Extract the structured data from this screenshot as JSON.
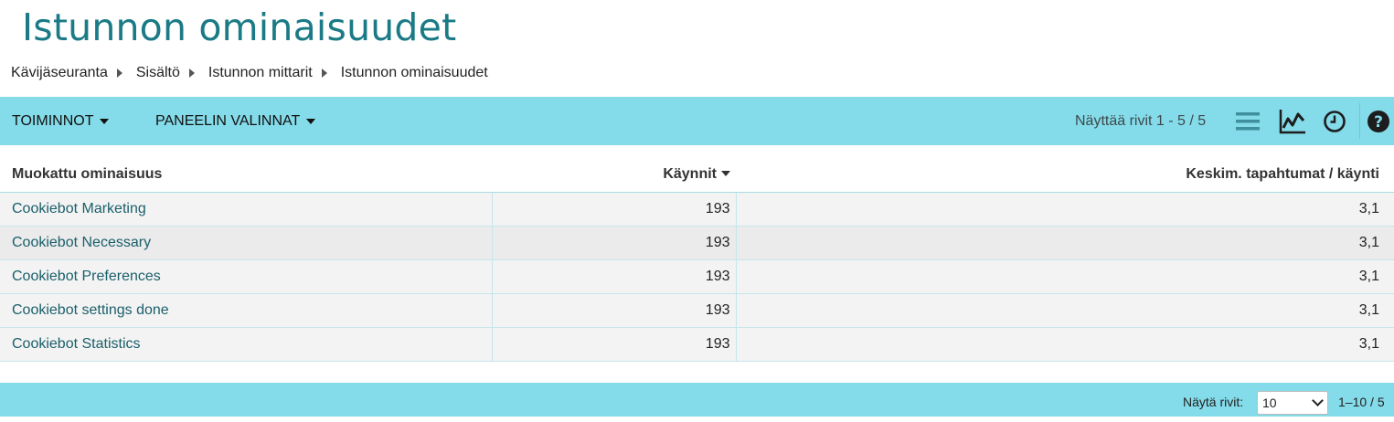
{
  "page": {
    "title": "Istunnon ominaisuudet"
  },
  "breadcrumb": [
    "Kävijäseuranta",
    "Sisältö",
    "Istunnon mittarit",
    "Istunnon ominaisuudet"
  ],
  "toolbar": {
    "actions_label": "TOIMINNOT",
    "panel_options_label": "PANEELIN VALINNAT",
    "rows_info": "Näyttää rivit 1 - 5 / 5",
    "icons": [
      "table-view-icon",
      "line-chart-icon",
      "clock-icon",
      "help-icon"
    ]
  },
  "table": {
    "columns": [
      "Muokattu ominaisuus",
      "Käynnit",
      "Keskim. tapahtumat / käynti"
    ],
    "rows": [
      [
        "Cookiebot Marketing",
        "193",
        "3,1"
      ],
      [
        "Cookiebot Necessary",
        "193",
        "3,1"
      ],
      [
        "Cookiebot Preferences",
        "193",
        "3,1"
      ],
      [
        "Cookiebot settings done",
        "193",
        "3,1"
      ],
      [
        "Cookiebot Statistics",
        "193",
        "3,1"
      ]
    ]
  },
  "footer": {
    "rows_label": "Näytä rivit:",
    "rows_value": "10",
    "pager": "1–10 / 5"
  },
  "colors": {
    "accent": "#84dbe9",
    "title": "#1a7a86",
    "link": "#1a5f6a"
  }
}
